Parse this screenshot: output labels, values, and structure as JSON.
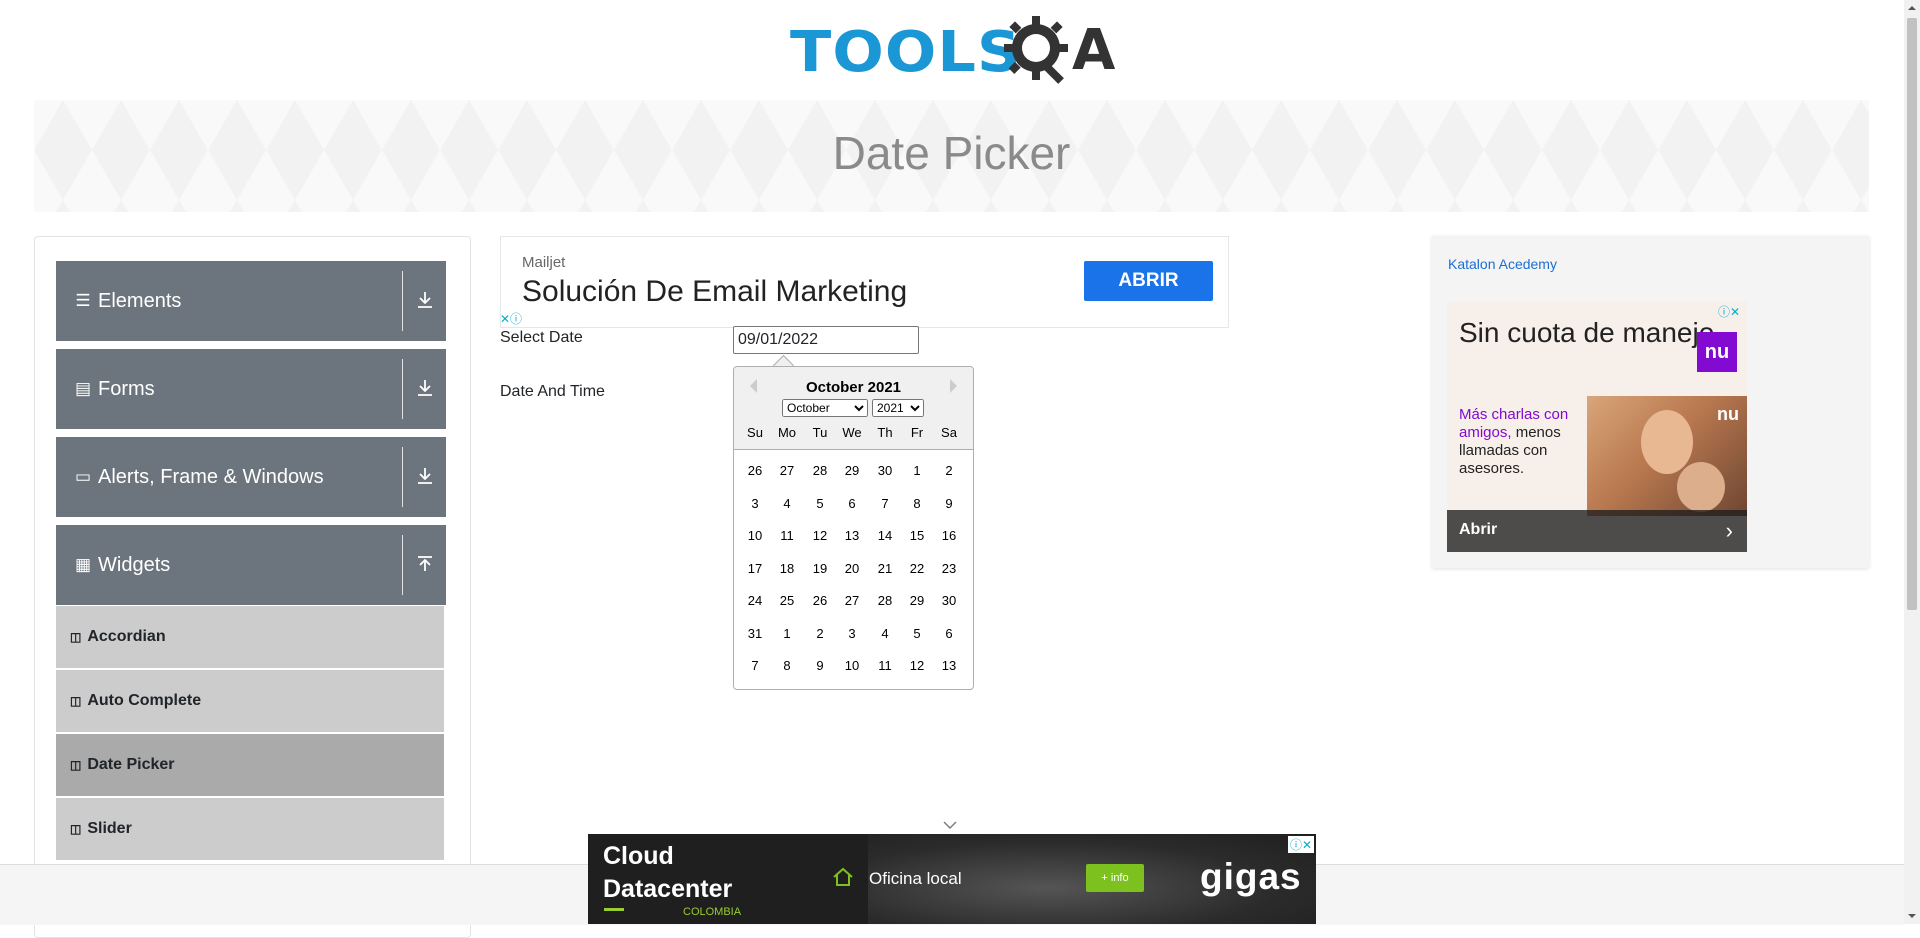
{
  "header": {
    "logo_text": "TOOLS",
    "logo_text_end": "A"
  },
  "banner": {
    "title": "Date Picker"
  },
  "sidebar": {
    "groups": [
      {
        "label": "Elements",
        "icon": "menu-icon",
        "expanded": false
      },
      {
        "label": "Forms",
        "icon": "document-icon",
        "expanded": false
      },
      {
        "label": "Alerts, Frame & Windows",
        "icon": "window-icon",
        "expanded": false
      },
      {
        "label": "Widgets",
        "icon": "grid-icon",
        "expanded": true
      }
    ],
    "items": [
      {
        "label": "Accordian",
        "active": false
      },
      {
        "label": "Auto Complete",
        "active": false
      },
      {
        "label": "Date Picker",
        "active": true
      },
      {
        "label": "Slider",
        "active": false
      }
    ]
  },
  "ad_top": {
    "brand": "Mailjet",
    "headline": "Solución De Email Marketing",
    "cta": "ABRIR"
  },
  "form": {
    "select_date_label": "Select Date",
    "select_date_value": "09/01/2022",
    "date_time_label": "Date And Time"
  },
  "calendar": {
    "month_title": "October 2021",
    "month_select": "October",
    "year_select": "2021",
    "weekdays": [
      "Su",
      "Mo",
      "Tu",
      "We",
      "Th",
      "Fr",
      "Sa"
    ],
    "weeks": [
      [
        "26",
        "27",
        "28",
        "29",
        "30",
        "1",
        "2"
      ],
      [
        "3",
        "4",
        "5",
        "6",
        "7",
        "8",
        "9"
      ],
      [
        "10",
        "11",
        "12",
        "13",
        "14",
        "15",
        "16"
      ],
      [
        "17",
        "18",
        "19",
        "20",
        "21",
        "22",
        "23"
      ],
      [
        "24",
        "25",
        "26",
        "27",
        "28",
        "29",
        "30"
      ],
      [
        "31",
        "1",
        "2",
        "3",
        "4",
        "5",
        "6"
      ],
      [
        "7",
        "8",
        "9",
        "10",
        "11",
        "12",
        "13"
      ]
    ]
  },
  "ad_right": {
    "image_alt": "Katalon Acedemy",
    "headline": "Sin cuota de manejo",
    "logo": "nu",
    "body_purple": "Más charlas con amigos,",
    "body_dark": "menos llamadas con asesores.",
    "cta": "Abrir",
    "brand_color": "#820ad1"
  },
  "ad_bottom": {
    "title_line1": "Cloud",
    "title_line2": "Datacenter",
    "country": "COLOMBIA",
    "office": "Oficina local",
    "info": "+ info",
    "brand": "gigas"
  },
  "colors": {
    "sidebar_header": "#6c757d",
    "sidebar_item": "#cccccc",
    "sidebar_item_active": "#aaaaaa",
    "logo_blue": "#1b97d6",
    "cta_blue": "#1a73e8"
  }
}
